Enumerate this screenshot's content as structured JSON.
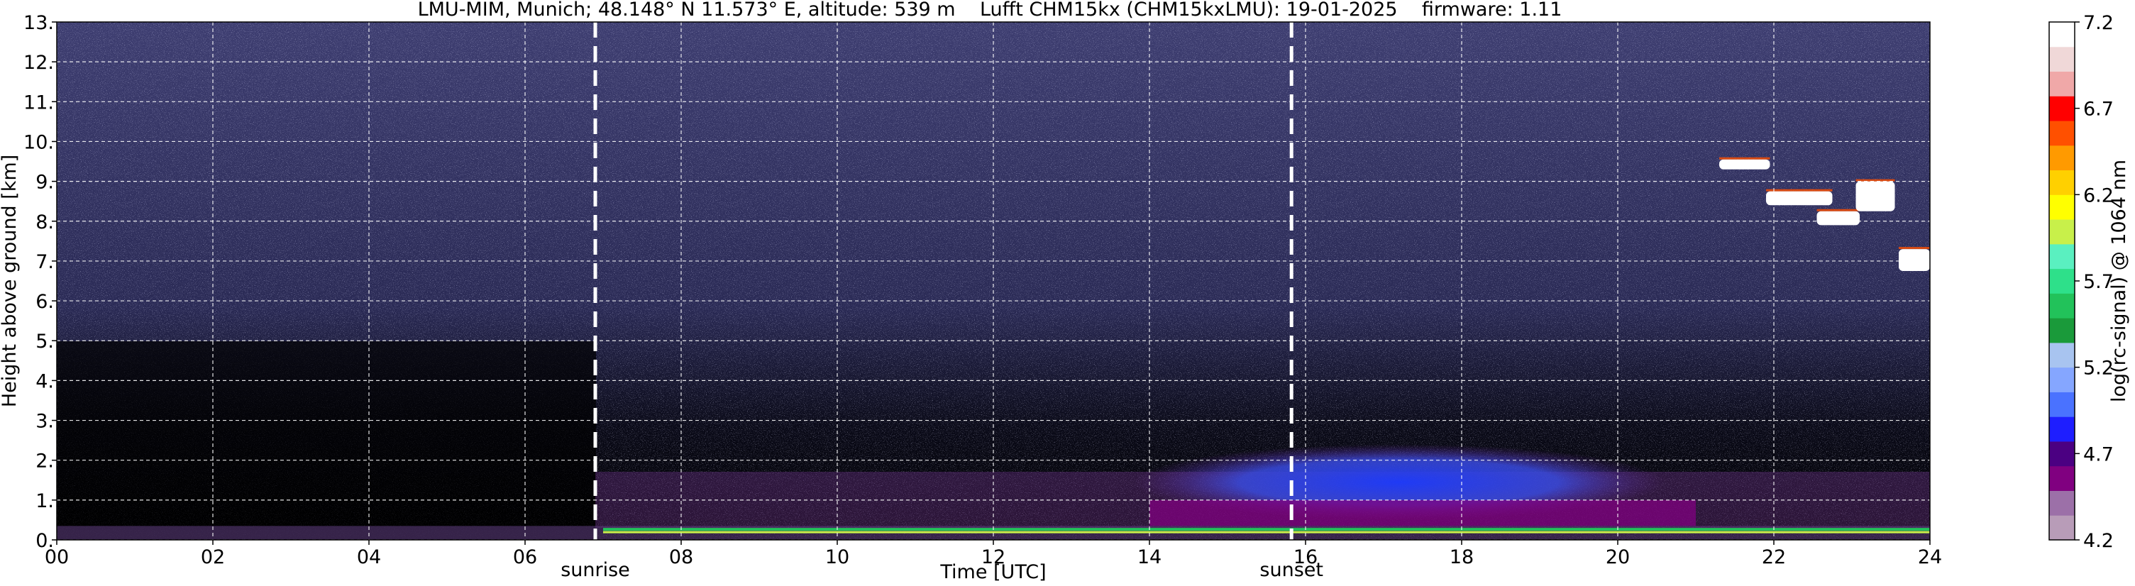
{
  "chart_data": {
    "type": "heatmap",
    "title": "LMU-MIM, Munich; 48.148° N 11.573° E, altitude: 539 m    Lufft CHM15kx (CHM15kxLMU): 19-01-2025    firmware: 1.11",
    "xlabel": "Time [UTC]",
    "ylabel": "Height above ground [km]",
    "xlim": [
      0,
      24
    ],
    "ylim": [
      0,
      13
    ],
    "x_ticks": [
      "00",
      "02",
      "04",
      "06",
      "08",
      "10",
      "12",
      "14",
      "16",
      "18",
      "20",
      "22",
      "24"
    ],
    "y_ticks": [
      "0.",
      "1.",
      "2.",
      "3.",
      "4.",
      "5.",
      "6.",
      "7.",
      "8.",
      "9.",
      "10.",
      "11.",
      "12.",
      "13."
    ],
    "grid": true,
    "markers": [
      {
        "label": "sunrise",
        "x": 6.9
      },
      {
        "label": "sunset",
        "x": 15.82
      }
    ],
    "colorbar": {
      "label": "log(rc-signal) @ 1064 nm",
      "range": [
        4.2,
        7.2
      ],
      "ticks": [
        "4.2",
        "4.7",
        "5.2",
        "5.7",
        "6.2",
        "6.7",
        "7.2"
      ],
      "colors": [
        "#b89cb8",
        "#9c70a8",
        "#800080",
        "#4b0082",
        "#1e1eff",
        "#4a72ff",
        "#85a6ff",
        "#a8c4f0",
        "#1a9a3a",
        "#22c25a",
        "#2ee08a",
        "#5af0c0",
        "#c8f04a",
        "#ffff00",
        "#ffd000",
        "#ff9a00",
        "#ff5000",
        "#ff0000",
        "#f0a8a8",
        "#f0d8d8",
        "#ffffff"
      ]
    },
    "features": [
      {
        "name": "aerosol layer",
        "x_range": [
          6.9,
          24
        ],
        "height_km": [
          0.3,
          2.6
        ]
      },
      {
        "name": "cloud",
        "x_range": [
          21,
          24
        ],
        "height_km": [
          6.7,
          9.8
        ]
      },
      {
        "name": "surface layer",
        "x_range": [
          0,
          24
        ],
        "height_km": [
          0,
          0.35
        ]
      }
    ]
  }
}
